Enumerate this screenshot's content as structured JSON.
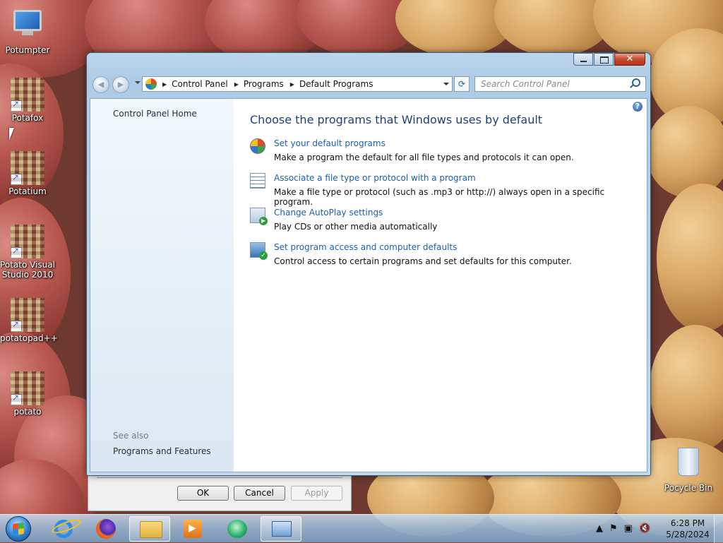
{
  "desktop": {
    "icons": [
      {
        "label": "Potumpter"
      },
      {
        "label": "Potafox"
      },
      {
        "label": "Potatium"
      },
      {
        "label": "Potato Visual Studio 2010"
      },
      {
        "label": "potatopad++"
      },
      {
        "label": "potato"
      }
    ],
    "recycle_bin": {
      "label": "Pocycle Bin"
    }
  },
  "window": {
    "address": {
      "crumbs": [
        "Control Panel",
        "Programs",
        "Default Programs"
      ],
      "refresh_glyph": "⟳"
    },
    "search": {
      "placeholder": "Search Control Panel"
    },
    "help_glyph": "?",
    "left_pane": {
      "home": "Control Panel Home",
      "see_also": "See also",
      "programs_and_features": "Programs and Features"
    },
    "main": {
      "title": "Choose the programs that Windows uses by default",
      "tasks": [
        {
          "link": "Set your default programs",
          "desc": "Make a program the default for all file types and protocols it can open.",
          "icon": "default-programs-icon"
        },
        {
          "link": "Associate a file type or protocol with a program",
          "desc": "Make a file type or protocol (such as .mp3 or http://) always open in a specific program.",
          "icon": "file-association-icon"
        },
        {
          "link": "Change AutoPlay settings",
          "desc": "Play CDs or other media automatically",
          "icon": "autoplay-icon"
        },
        {
          "link": "Set program access and computer defaults",
          "desc": "Control access to certain programs and set defaults for this computer.",
          "icon": "program-access-icon"
        }
      ]
    }
  },
  "dialog": {
    "ok": "OK",
    "cancel": "Cancel",
    "apply": "Apply"
  },
  "taskbar": {
    "items": [
      "internet-explorer-icon",
      "firefox-icon",
      "file-explorer-icon",
      "media-player-icon",
      "green-app-icon",
      "control-panel-icon"
    ],
    "clock": {
      "time": "6:28 PM",
      "date": "5/28/2024"
    },
    "tray": [
      "show-hidden-icons",
      "action-center-flag-icon",
      "network-icon",
      "volume-muted-icon"
    ]
  },
  "colors": {
    "link": "#1a5fb4",
    "heading": "#1e3f7a",
    "window_frame": "#aecbe6"
  }
}
